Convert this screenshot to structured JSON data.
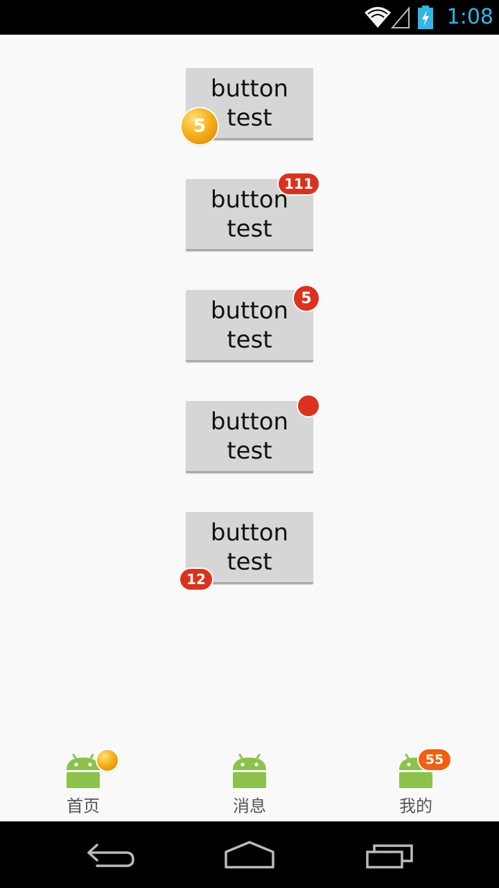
{
  "status_bar": {
    "time": "1:08",
    "icons": [
      "wifi-icon",
      "signal-icon",
      "battery-charging-icon"
    ],
    "accent_color": "#33b5e5"
  },
  "buttons": [
    {
      "label": "button\ntest",
      "badge": {
        "text": "5",
        "style": "orb",
        "position": "bottom-left"
      }
    },
    {
      "label": "button\ntest",
      "badge": {
        "text": "111",
        "style": "pill",
        "position": "top-right"
      }
    },
    {
      "label": "button\ntest",
      "badge": {
        "text": "5",
        "style": "circle",
        "position": "top-right"
      }
    },
    {
      "label": "button\ntest",
      "badge": {
        "text": "",
        "style": "dot",
        "position": "top-right"
      }
    },
    {
      "label": "button\ntest",
      "badge": {
        "text": "12",
        "style": "pill",
        "position": "bottom-left"
      }
    }
  ],
  "tabs": [
    {
      "label": "首页",
      "icon": "android-icon",
      "badge": {
        "text": "",
        "style": "orb"
      }
    },
    {
      "label": "消息",
      "icon": "android-icon",
      "badge": null
    },
    {
      "label": "我的",
      "icon": "android-icon",
      "badge": {
        "text": "55",
        "style": "pill"
      }
    }
  ],
  "nav_bar": {
    "buttons": [
      "back-icon",
      "home-icon",
      "recents-icon"
    ]
  },
  "colors": {
    "badge_red": "#d9331f",
    "badge_orange": "#f35f10",
    "android_green": "#8bc34a"
  }
}
